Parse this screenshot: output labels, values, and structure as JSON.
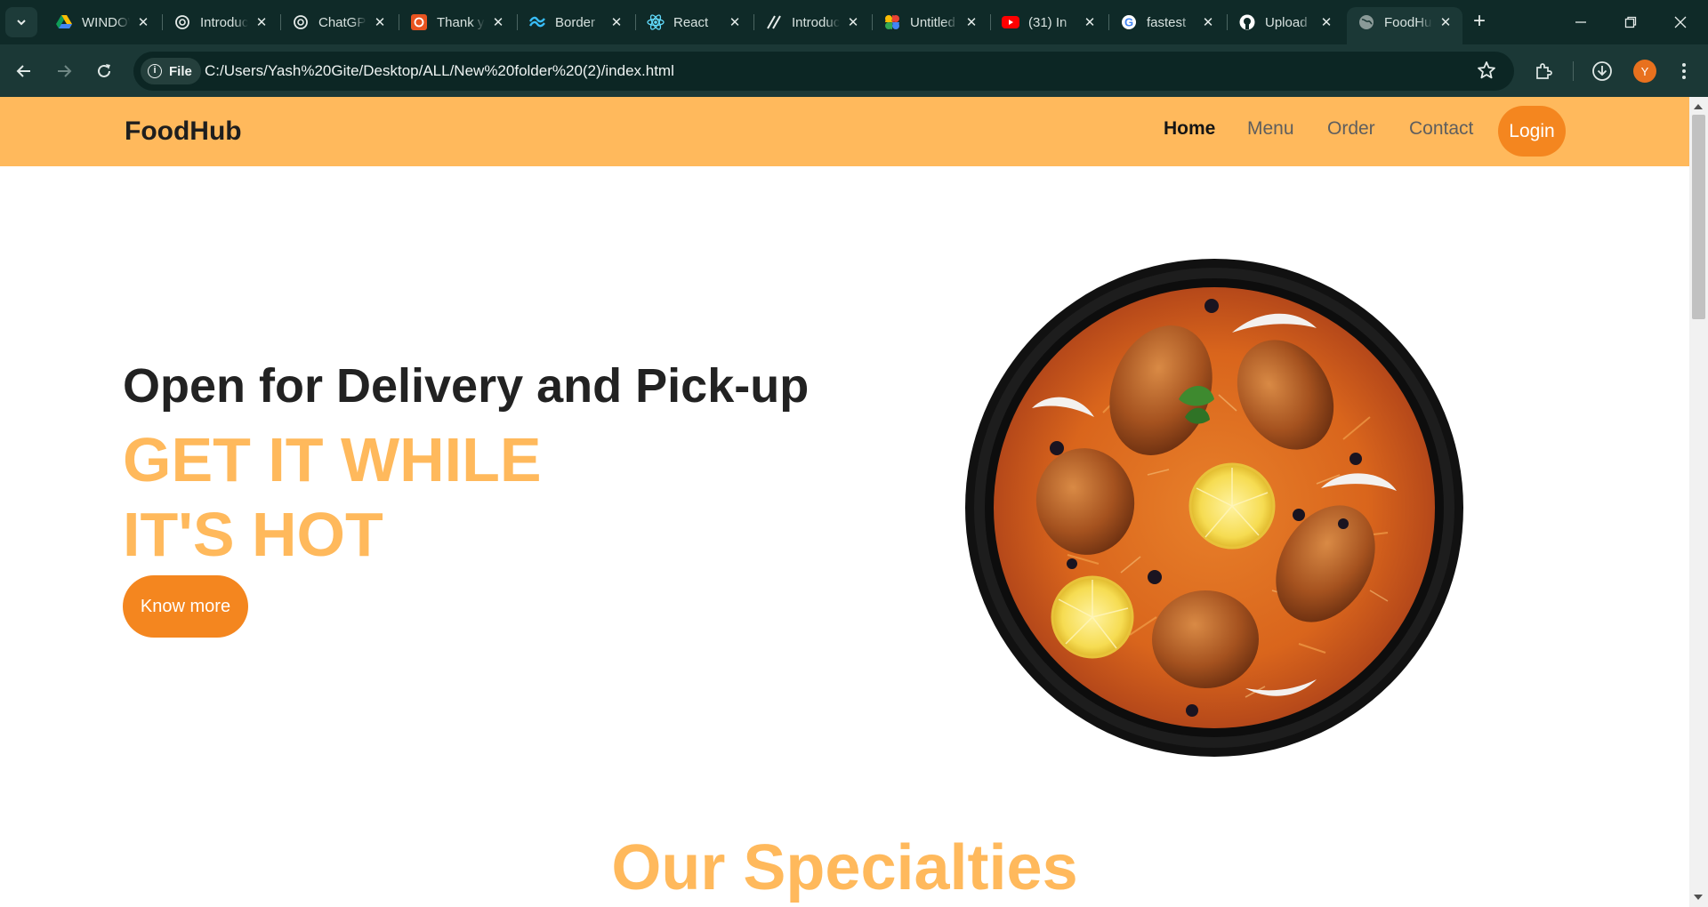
{
  "browser": {
    "tabs": [
      {
        "title": "WINDOWS",
        "icon": "drive-icon"
      },
      {
        "title": "Introduction",
        "icon": "openai-icon"
      },
      {
        "title": "ChatGPT",
        "icon": "openai-icon"
      },
      {
        "title": "Thank you",
        "icon": "ubuntu-icon"
      },
      {
        "title": "Border",
        "icon": "tailwind-icon"
      },
      {
        "title": "React",
        "icon": "react-icon"
      },
      {
        "title": "Introduction",
        "icon": "slash-icon"
      },
      {
        "title": "Untitled",
        "icon": "photos-icon"
      },
      {
        "title": "(31) In",
        "icon": "youtube-icon"
      },
      {
        "title": "fastest",
        "icon": "google-icon"
      },
      {
        "title": "Upload",
        "icon": "github-icon"
      },
      {
        "title": "FoodHub",
        "icon": "globe-icon",
        "active": true
      }
    ],
    "site_chip": "File",
    "url": "C:/Users/Yash%20Gite/Desktop/ALL/New%20folder%20(2)/index.html",
    "avatar_letter": "Y"
  },
  "site": {
    "brand": "FoodHub",
    "nav": {
      "home": "Home",
      "menu": "Menu",
      "order": "Order",
      "contact": "Contact",
      "login": "Login"
    },
    "hero": {
      "subtitle": "Open for Delivery and Pick-up",
      "headline_line1": "GET IT WHILE",
      "headline_line2": "IT'S HOT",
      "cta": "Know more"
    },
    "specialties_title": "Our Specialties"
  },
  "colors": {
    "accent_light": "#ffb95c",
    "accent_dark": "#f4861f",
    "browser_frame": "#0f2a28"
  }
}
